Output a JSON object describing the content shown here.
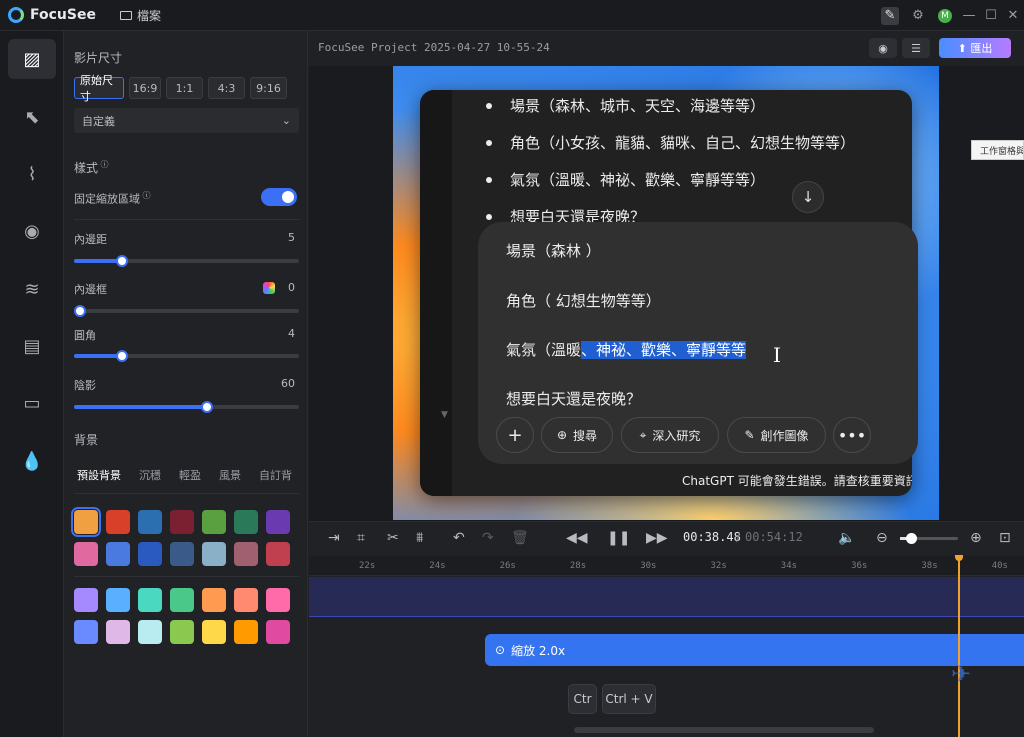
{
  "app": {
    "name": "FocuSee",
    "file_menu": "檔案",
    "project_title": "FocuSee Project 2025-04-27 10-55-24",
    "export_label": "匯出",
    "avatar_letter": "M"
  },
  "rail": [
    "aspect-ratio-icon",
    "cursor-icon",
    "path-icon",
    "webcam-icon",
    "audio-wave-icon",
    "captions-icon",
    "subtitle-icon",
    "watermark-icon"
  ],
  "panel": {
    "video_size_title": "影片尺寸",
    "ratios": [
      "原始尺寸",
      "16:9",
      "1:1",
      "4:3",
      "9:16"
    ],
    "custom_select": "自定義",
    "style_title": "樣式",
    "fixed_zoom_label": "固定縮放區域",
    "fixed_zoom_on": true,
    "padding": {
      "label": "內邊距",
      "value": "5"
    },
    "inner_border": {
      "label": "內邊框",
      "value": "0"
    },
    "corner": {
      "label": "圓角",
      "value": "4"
    },
    "shadow": {
      "label": "陰影",
      "value": "60"
    },
    "background_title": "背景",
    "bg_tabs": [
      "預設背景",
      "沉穩",
      "輕盈",
      "風景",
      "自訂背"
    ],
    "swatches_row1": [
      "#f0a040",
      "#d8402a",
      "#2c6fb0",
      "#7a2030",
      "#5aa040",
      "#2a7a5a",
      "#6a3ab0"
    ],
    "swatches_row2": [
      "#e06aa0",
      "#4a7ae0",
      "#2a5ac0",
      "#3a5a8a",
      "#8ab0c8",
      "#a06070",
      "#c04050"
    ],
    "swatches_row3": [
      "#a58aff",
      "#5ab0ff",
      "#4ad8c0",
      "#4ac88a",
      "#ff9a50",
      "#ff8a70",
      "#ff6aa8"
    ],
    "swatches_row4": [
      "#6a8aff",
      "#e0b8e8",
      "#b8ecf0",
      "#8ac850",
      "#ffd84a",
      "#ff9a00",
      "#e04aa0"
    ]
  },
  "preview": {
    "bullets": [
      "場景（森林、城市、天空、海邊等等）",
      "角色（小女孩、龍貓、貓咪、自己、幻想生物等等）",
      "氣氛（溫暖、神祕、歡樂、寧靜等等）",
      "想要白天還是夜晚？"
    ],
    "composer_lines": [
      "場景（森林 ）",
      "角色（ 幻想生物等等）",
      "想要白天還是夜晚？"
    ],
    "composer_line3_plain": "氣氛（溫暖",
    "composer_line3_selected": "、神祕、歡樂、寧靜等等",
    "chips": [
      "搜尋",
      "深入研究",
      "創作圖像"
    ],
    "disclaimer": "ChatGPT 可能會發生錯誤。請查核重要資訊。",
    "tooltip": "工作窗格與"
  },
  "playback": {
    "current": "00:38.48",
    "separator": "/",
    "total": "00:54:12"
  },
  "timeline": {
    "ticks": [
      "22s",
      "24s",
      "26s",
      "28s",
      "30s",
      "32s",
      "34s",
      "36s",
      "38s",
      "40s"
    ],
    "zoom_clip": "縮放  2.0x",
    "keys": [
      "Ctr",
      "Ctrl + V"
    ]
  }
}
